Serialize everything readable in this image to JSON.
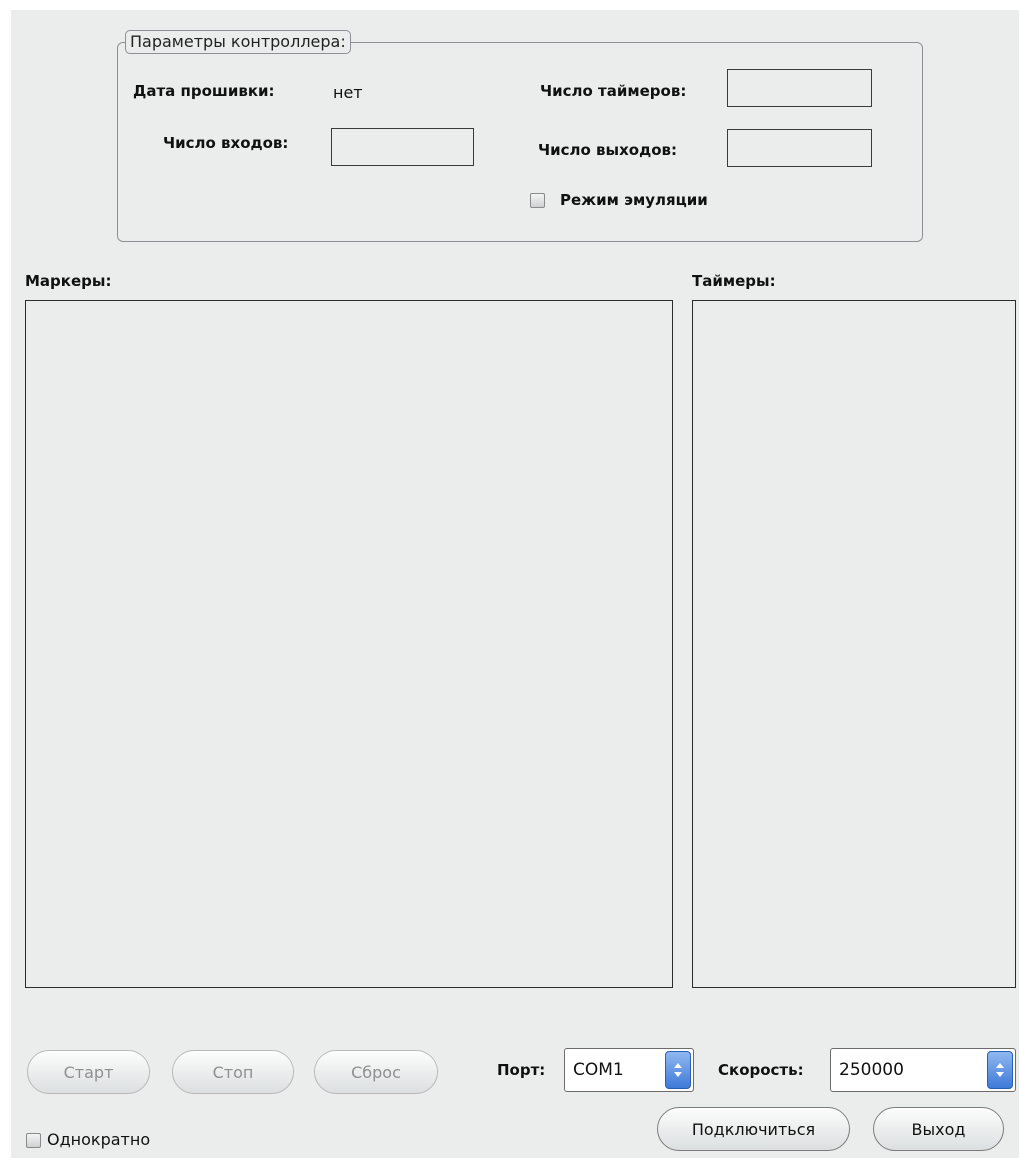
{
  "controller_group": {
    "title": "Параметры контроллера:",
    "firmware_date_label": "Дата прошивки:",
    "firmware_date_value": "нет",
    "timers_count_label": "Число таймеров:",
    "timers_count_value": "",
    "inputs_count_label": "Число входов:",
    "inputs_count_value": "",
    "outputs_count_label": "Число выходов:",
    "outputs_count_value": "",
    "emulation_mode_label": "Режим эмуляции",
    "emulation_mode_checked": false
  },
  "markers": {
    "label": "Маркеры:",
    "items": []
  },
  "timers": {
    "label": "Таймеры:",
    "items": []
  },
  "buttons": {
    "start": "Старт",
    "stop": "Стоп",
    "reset": "Сброс",
    "connect": "Подключиться",
    "exit": "Выход"
  },
  "port": {
    "label": "Порт:",
    "value": "COM1"
  },
  "speed": {
    "label": "Скорость:",
    "value": "250000"
  },
  "once": {
    "label": "Однократно",
    "checked": false
  },
  "icons": {
    "spinner": "up-down-arrows-icon",
    "checkbox": "checkbox-icon"
  }
}
